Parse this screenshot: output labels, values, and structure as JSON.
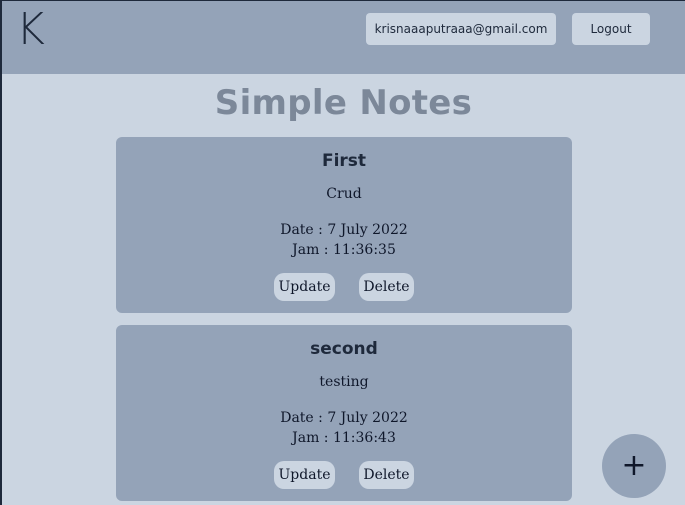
{
  "header": {
    "logo": "K",
    "email": "krisnaaaputraaa@gmail.com",
    "logout_label": "Logout"
  },
  "page_title": "Simple Notes",
  "notes": [
    {
      "title": "First",
      "body": "Crud",
      "date": "Date : 7 July 2022",
      "time": "Jam : 11:36:35",
      "update_label": "Update",
      "delete_label": "Delete"
    },
    {
      "title": "second",
      "body": "testing",
      "date": "Date : 7 July 2022",
      "time": "Jam : 11:36:43",
      "update_label": "Update",
      "delete_label": "Delete"
    }
  ],
  "fab": {
    "icon": "plus-icon",
    "symbol": "+"
  },
  "colors": {
    "page_bg": "#cbd5e1",
    "header_bg": "#94a3b8",
    "card_bg": "#94a3b8",
    "title_color": "#7c8899"
  }
}
